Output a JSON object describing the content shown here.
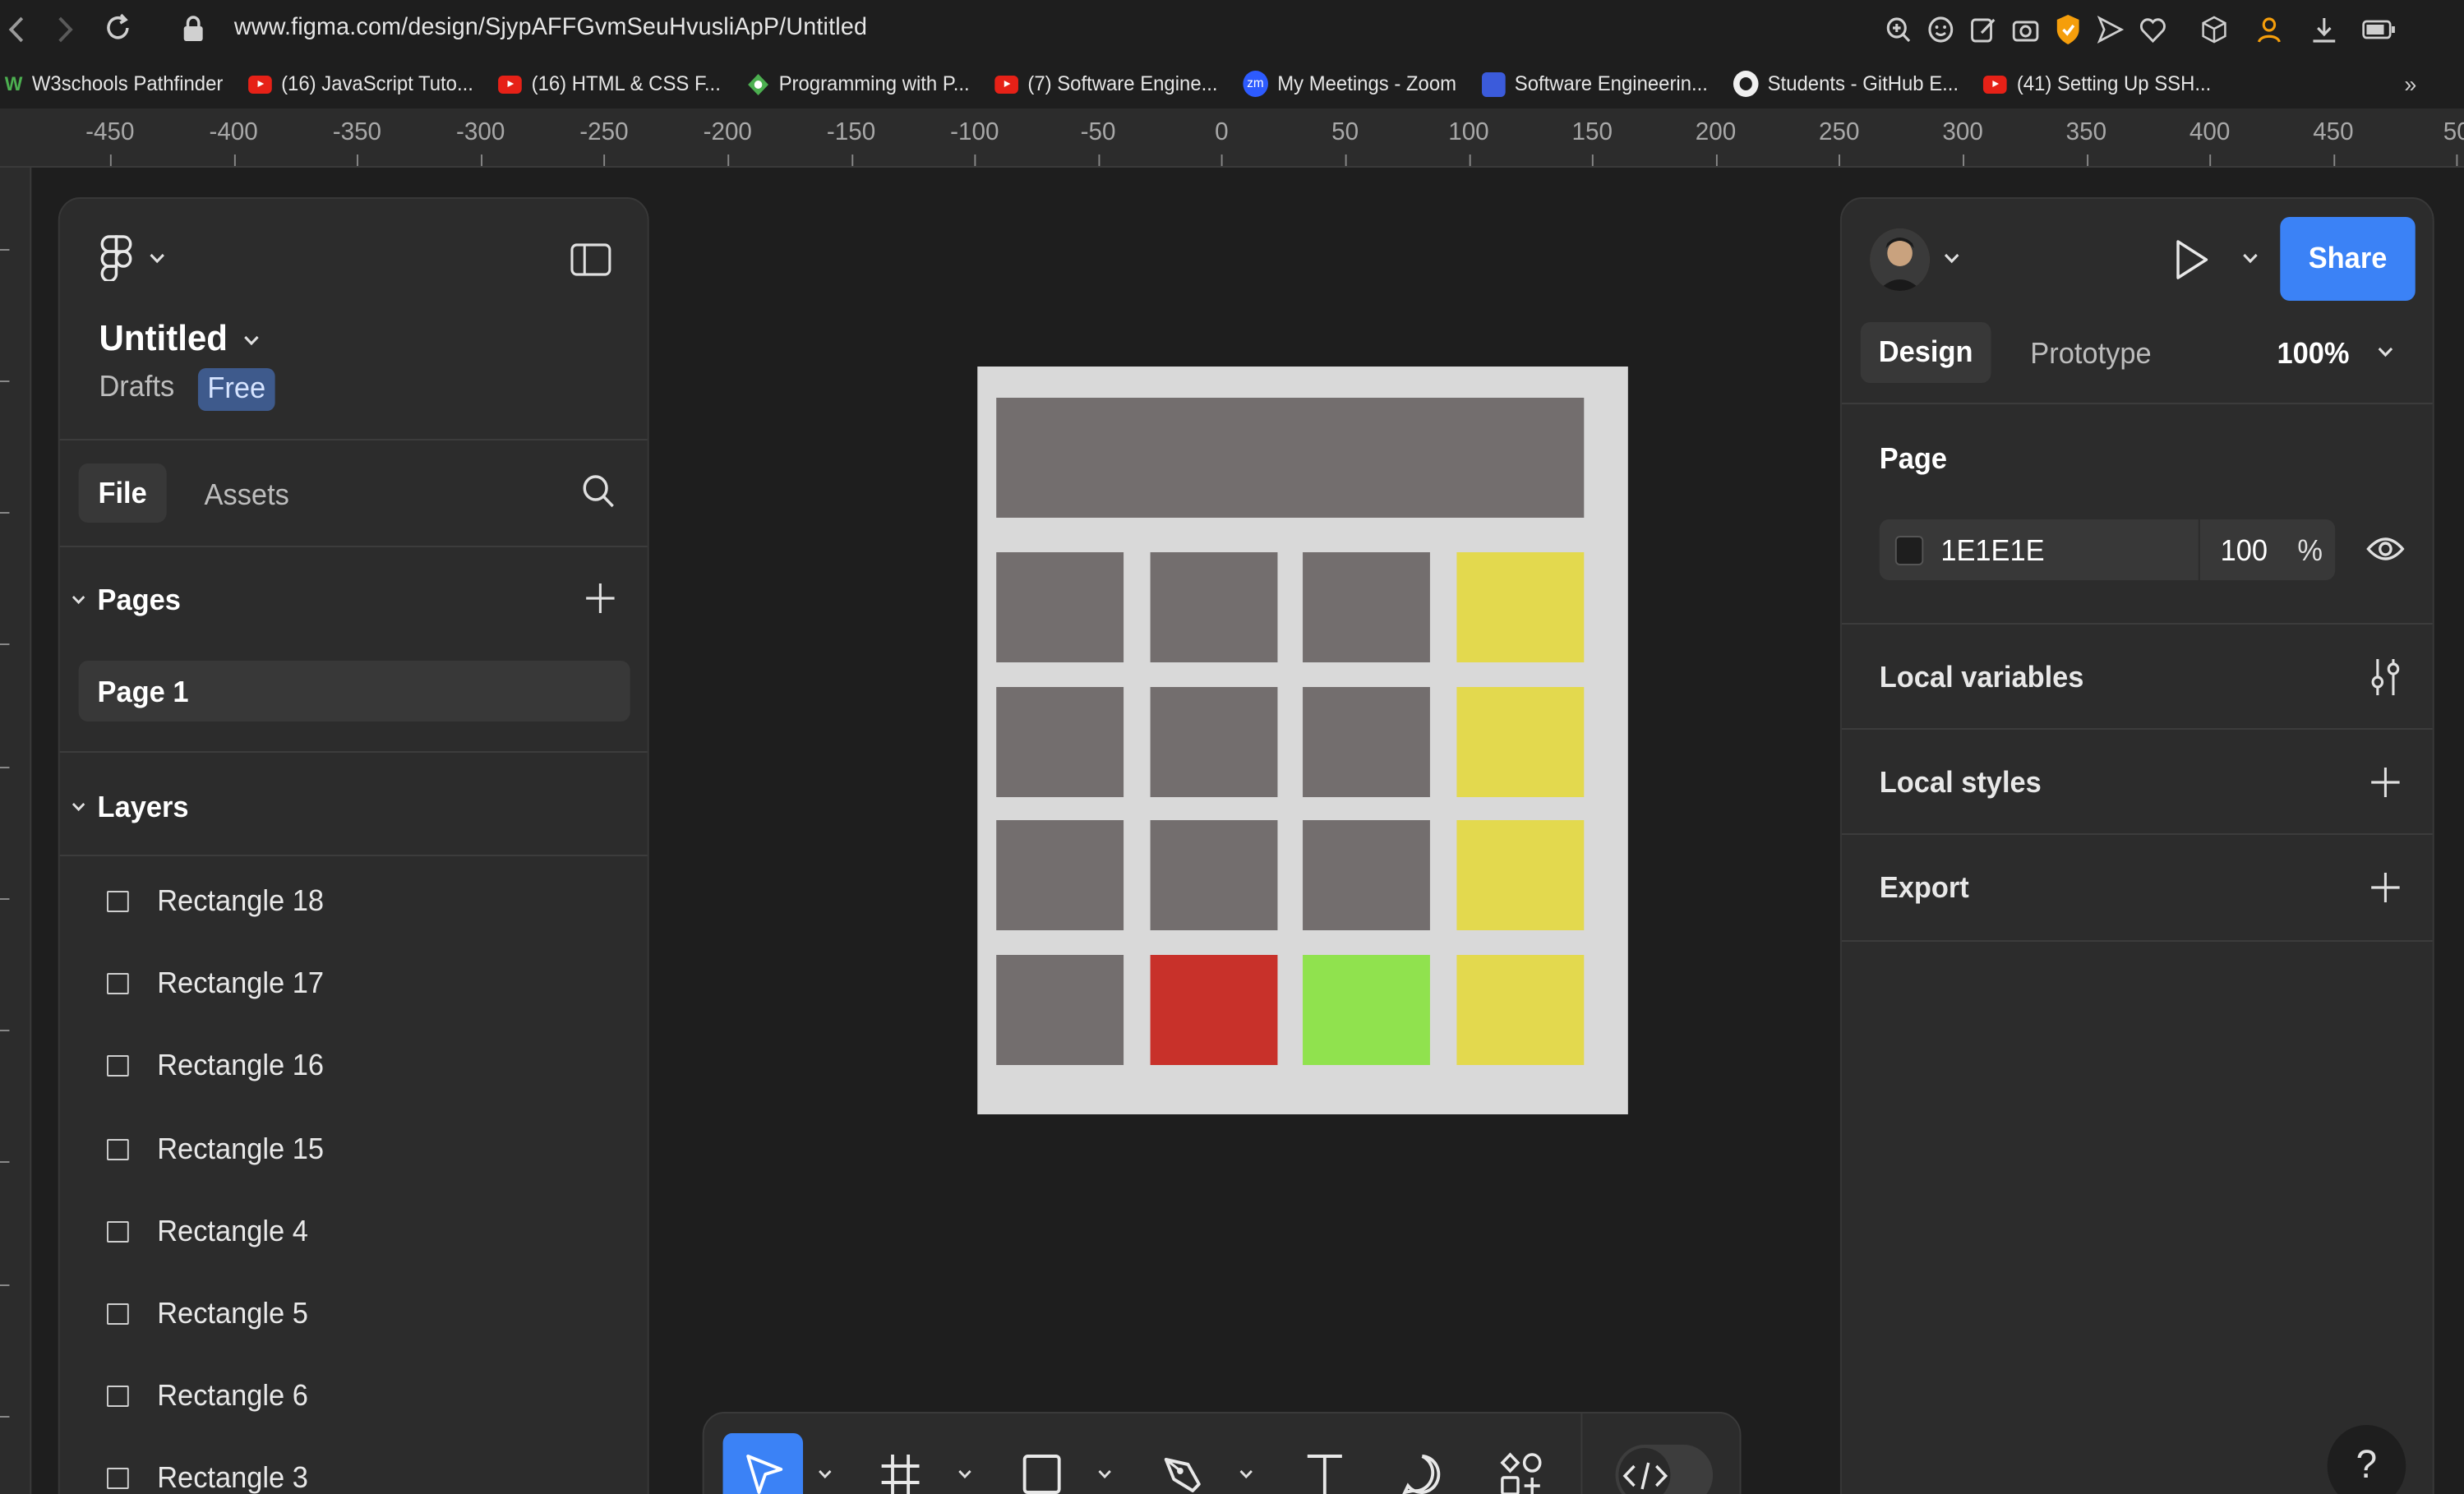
{
  "browser": {
    "url": "www.figma.com/design/SjypAFFGvmSeuHvusliApP/Untitled",
    "bookmarks": [
      {
        "label": "W3schools Pathfinder",
        "icon": "w3schools-icon"
      },
      {
        "label": "(16) JavaScript Tuto...",
        "icon": "youtube-icon"
      },
      {
        "label": "(16) HTML & CSS F...",
        "icon": "youtube-icon"
      },
      {
        "label": "Programming with P...",
        "icon": "programming-icon"
      },
      {
        "label": "(7) Software Engine...",
        "icon": "youtube-icon"
      },
      {
        "label": "My Meetings - Zoom",
        "icon": "zoom-icon"
      },
      {
        "label": "Software Engineerin...",
        "icon": "profile-icon"
      },
      {
        "label": "Students - GitHub E...",
        "icon": "github-icon"
      },
      {
        "label": "(41) Setting Up SSH...",
        "icon": "youtube-icon"
      }
    ]
  },
  "ruler": {
    "labels": [
      "-450",
      "-400",
      "-350",
      "-300",
      "-250",
      "-200",
      "-150",
      "-100",
      "-50",
      "0",
      "50",
      "100",
      "150",
      "200",
      "250",
      "300",
      "350",
      "400",
      "450",
      "50"
    ]
  },
  "left_panel": {
    "file_title": "Untitled",
    "location": "Drafts",
    "plan_badge": "Free",
    "tab_file": "File",
    "tab_assets": "Assets",
    "pages_label": "Pages",
    "page_item": "Page 1",
    "layers_label": "Layers",
    "layers": [
      "Rectangle 18",
      "Rectangle 17",
      "Rectangle 16",
      "Rectangle 15",
      "Rectangle 4",
      "Rectangle 5",
      "Rectangle 6",
      "Rectangle 3"
    ]
  },
  "right_panel": {
    "share_label": "Share",
    "tab_design": "Design",
    "tab_prototype": "Prototype",
    "zoom": "100%",
    "page_section": "Page",
    "page_color_hex": "1E1E1E",
    "page_opacity": "100",
    "opacity_unit": "%",
    "local_variables": "Local variables",
    "local_styles": "Local styles",
    "export": "Export",
    "help": "?"
  },
  "colors": {
    "canvas": "#1e1e1e",
    "panel": "#2c2c2c",
    "accent": "#3b82f6",
    "calc_body": "#d9d9d9",
    "key_gray": "#736e6e",
    "key_yellow": "#e3d94e",
    "key_red": "#c8312a",
    "key_green": "#90e24e"
  },
  "canvas_design": {
    "rows": [
      [
        "gray",
        "gray",
        "gray",
        "yellow"
      ],
      [
        "gray",
        "gray",
        "gray",
        "yellow"
      ],
      [
        "gray",
        "gray",
        "gray",
        "yellow"
      ],
      [
        "gray",
        "red",
        "green",
        "yellow"
      ]
    ]
  }
}
